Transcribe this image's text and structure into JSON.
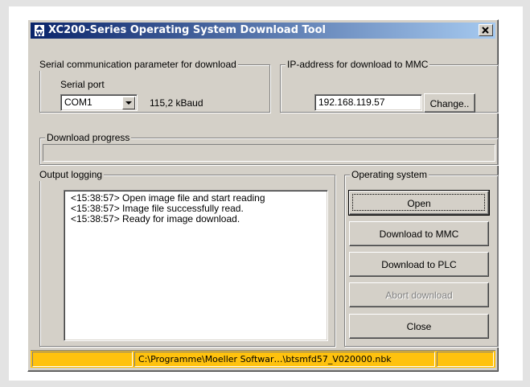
{
  "window": {
    "title": "XC200-Series Operating System Download Tool",
    "close_glyph": "✕"
  },
  "serial": {
    "group_label": "Serial communication parameter for download",
    "port_label": "Serial port",
    "port_value": "COM1",
    "baud_text": "115,2 kBaud"
  },
  "ip": {
    "group_label": "IP-address for download to MMC",
    "value": "192.168.119.57",
    "change_label": "Change.."
  },
  "progress": {
    "group_label": "Download progress",
    "value": 0
  },
  "output": {
    "group_label": "Output logging",
    "lines": [
      "<15:38:57> Open image file and start reading",
      "<15:38:57> Image file successfully read.",
      "<15:38:57> Ready for image download."
    ]
  },
  "os": {
    "group_label": "Operating system",
    "open_label": "Open",
    "download_mmc_label": "Download to MMC",
    "download_plc_label": "Download to PLC",
    "abort_label": "Abort download",
    "close_label": "Close"
  },
  "status": {
    "path": "C:\\Programme\\Moeller Softwar…\\btsmfd57_V020000.nbk"
  },
  "colors": {
    "title_start": "#0a246a",
    "title_end": "#a6caf0",
    "dialog_bg": "#d4d0c8",
    "status_bar": "#ffc20e"
  },
  "icons": {
    "app": "moeller-logo-icon",
    "combo": "chevron-down-icon",
    "close": "close-icon"
  }
}
